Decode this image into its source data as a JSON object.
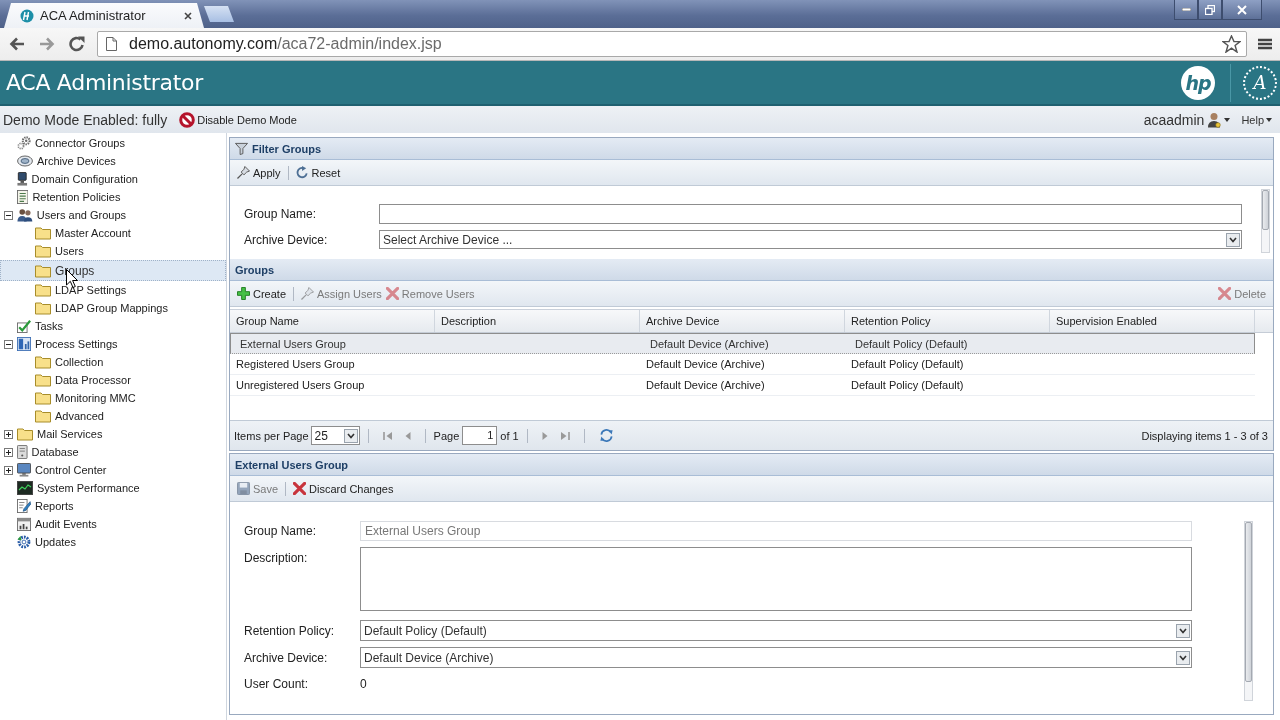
{
  "browser": {
    "tab_title": "ACA Administrator",
    "address": {
      "host": "demo.autonomy.com",
      "path": "/aca72-admin/index.jsp"
    }
  },
  "header": {
    "title": "ACA Administrator",
    "brand_mark": "hp",
    "product_mark": "A"
  },
  "demo_bar": {
    "status": "Demo Mode Enabled: fully",
    "disable_link": "Disable Demo Mode",
    "user": "acaadmin",
    "help": "Help"
  },
  "sidebar": {
    "items": [
      {
        "label": "Connector Groups",
        "kind": "gears",
        "selected": false
      },
      {
        "label": "Archive Devices",
        "kind": "disc",
        "selected": false
      },
      {
        "label": "Domain Configuration",
        "kind": "computer",
        "selected": false
      },
      {
        "label": "Retention Policies",
        "kind": "policy",
        "selected": false
      },
      {
        "label": "Users and Groups",
        "kind": "users",
        "selected": false,
        "expanded": true,
        "children": [
          {
            "label": "Master Account",
            "kind": "folder",
            "selected": false
          },
          {
            "label": "Users",
            "kind": "folder",
            "selected": false
          },
          {
            "label": "Groups",
            "kind": "folder",
            "selected": true
          },
          {
            "label": "LDAP Settings",
            "kind": "folder",
            "selected": false
          },
          {
            "label": "LDAP Group Mappings",
            "kind": "folder",
            "selected": false
          }
        ]
      },
      {
        "label": "Tasks",
        "kind": "tasks",
        "selected": false
      },
      {
        "label": "Process Settings",
        "kind": "process",
        "selected": false,
        "expanded": true,
        "children": [
          {
            "label": "Collection",
            "kind": "folder",
            "selected": false
          },
          {
            "label": "Data Processor",
            "kind": "folder",
            "selected": false
          },
          {
            "label": "Monitoring MMC",
            "kind": "folder",
            "selected": false
          },
          {
            "label": "Advanced",
            "kind": "folder",
            "selected": false
          }
        ]
      },
      {
        "label": "Mail Services",
        "kind": "folder",
        "selected": false,
        "expanded": false
      },
      {
        "label": "Database",
        "kind": "database",
        "selected": false,
        "expanded": false
      },
      {
        "label": "Control Center",
        "kind": "monitor",
        "selected": false,
        "expanded": false
      },
      {
        "label": "System Performance",
        "kind": "performance",
        "selected": false
      },
      {
        "label": "Reports",
        "kind": "reports",
        "selected": false
      },
      {
        "label": "Audit Events",
        "kind": "audit",
        "selected": false
      },
      {
        "label": "Updates",
        "kind": "updates",
        "selected": false
      }
    ]
  },
  "filter_panel": {
    "title": "Filter Groups",
    "toolbar": [
      {
        "kind": "apply",
        "label": "Apply",
        "disabled": false
      },
      {
        "kind": "reset",
        "label": "Reset",
        "disabled": false
      }
    ],
    "fields": [
      {
        "kind": "text",
        "label": "Group Name:"
      },
      {
        "kind": "select",
        "label": "Archive Device:",
        "placeholder": "Select Archive Device ..."
      }
    ]
  },
  "groups_panel": {
    "title": "Groups",
    "toolbar": [
      {
        "kind": "create",
        "label": "Create",
        "disabled": false
      },
      {
        "kind": "assign",
        "label": "Assign Users",
        "disabled": true
      },
      {
        "kind": "remove",
        "label": "Remove Users",
        "disabled": true
      }
    ],
    "toolbar_right": [
      {
        "kind": "delete",
        "label": "Delete",
        "disabled": true
      }
    ],
    "table": {
      "columns": [
        "Group Name",
        "Description",
        "Archive Device",
        "Retention Policy",
        "Supervision Enabled"
      ],
      "rows": [
        {
          "selected": true,
          "cells": [
            "External Users Group",
            null,
            "Default Device (Archive)",
            "Default Policy (Default)",
            null
          ]
        },
        {
          "selected": false,
          "cells": [
            "Registered Users Group",
            null,
            "Default Device (Archive)",
            "Default Policy (Default)",
            null
          ]
        },
        {
          "selected": false,
          "cells": [
            "Unregistered Users Group",
            null,
            "Default Device (Archive)",
            "Default Policy (Default)",
            null
          ]
        }
      ]
    },
    "pager": {
      "items_per_page_label": "Items per Page",
      "page_size": "25",
      "page_label": "Page",
      "page": "1",
      "page_count": "of 1",
      "summary": "Displaying items 1 - 3 of 3"
    }
  },
  "details_panel": {
    "title": "External Users Group",
    "toolbar": [
      {
        "kind": "save",
        "label": "Save",
        "disabled": true
      },
      {
        "kind": "discard",
        "label": "Discard Changes",
        "disabled": false
      }
    ],
    "fields": [
      {
        "kind": "text",
        "label": "Group Name:",
        "value": "External Users Group",
        "disabled": true
      },
      {
        "kind": "textarea",
        "label": "Description:",
        "disabled": false
      },
      {
        "kind": "select",
        "label": "Retention Policy:",
        "value": "Default Policy (Default)",
        "disabled": false
      },
      {
        "kind": "select",
        "label": "Archive Device:",
        "value": "Default Device (Archive)",
        "disabled": false
      },
      {
        "kind": "static",
        "label": "User Count:",
        "value": "0",
        "disabled": false
      }
    ]
  }
}
